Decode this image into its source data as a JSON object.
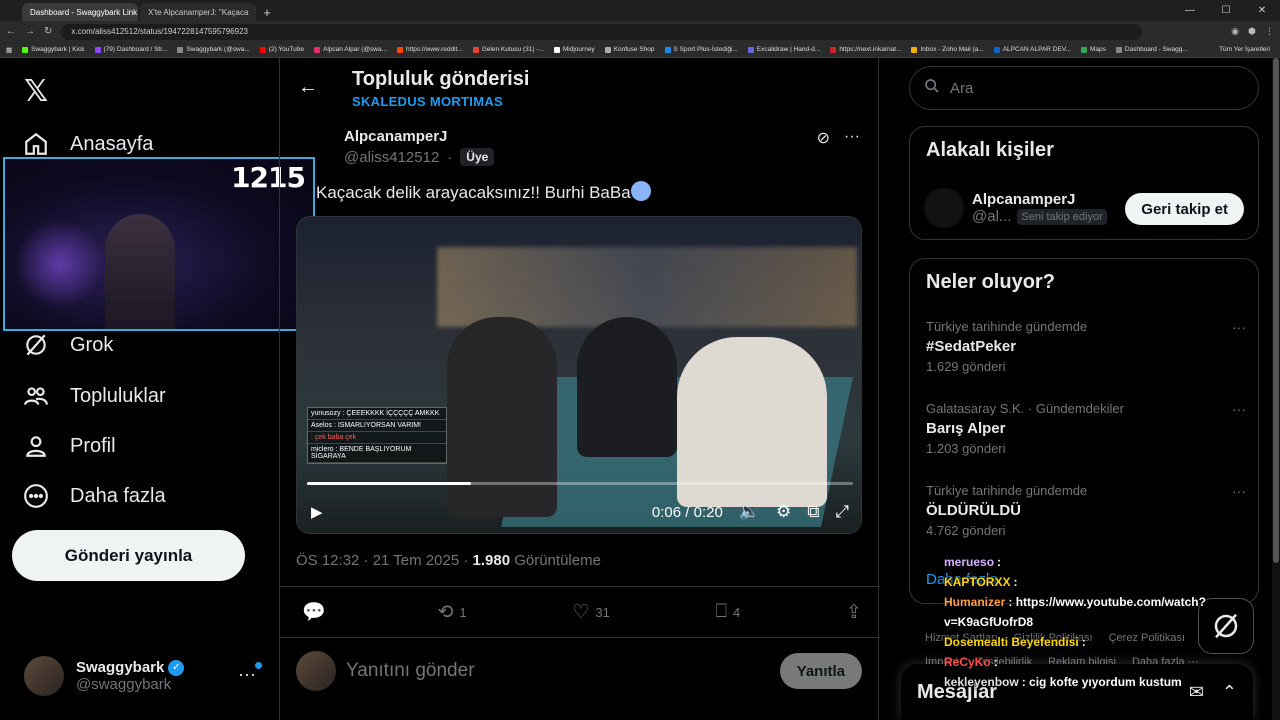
{
  "browser": {
    "tabs": [
      {
        "label": "Dashboard - Swaggybark Link"
      },
      {
        "label": "X'te AlpcanamperJ: \"Kaçaca"
      }
    ],
    "url": "x.com/aliss412512/status/1947228147595796923",
    "bookmarks": [
      {
        "label": "Swaggybark | Kick",
        "color": "#53fc18"
      },
      {
        "label": "(79) Dashboard / Str...",
        "color": "#9146ff"
      },
      {
        "label": "Swaggybark (@swa...",
        "color": "#888"
      },
      {
        "label": "(2) YouTube",
        "color": "#ff0000"
      },
      {
        "label": "Alpcan Alpar (@swa...",
        "color": "#e1306c"
      },
      {
        "label": "https://www.reddit...",
        "color": "#ff4500"
      },
      {
        "label": "Gelen Kutusu (31) -...",
        "color": "#ea4335"
      },
      {
        "label": "Midjourney",
        "color": "#fff"
      },
      {
        "label": "Konfuse Shop",
        "color": "#aaa"
      },
      {
        "label": "S Sport Plus-İstediği...",
        "color": "#1e88e5"
      },
      {
        "label": "Excalidraw | Hand-d...",
        "color": "#6965db"
      },
      {
        "label": "https://next.inkarnat...",
        "color": "#c62828"
      },
      {
        "label": "Inbox - Zoho Mail (a...",
        "color": "#f0b400"
      },
      {
        "label": "ALPCAN ALPAR DEV...",
        "color": "#1565c0"
      },
      {
        "label": "Maps",
        "color": "#34a853"
      },
      {
        "label": "Dashboard - Swagg...",
        "color": "#888"
      }
    ],
    "bookmarks_right": "Tüm Yer İşaretleri"
  },
  "sidebar": {
    "logo": "𝕏",
    "items": [
      {
        "label": "Anasayfa",
        "icon": "home-icon"
      },
      {
        "label": "Grok",
        "icon": "grok-icon"
      },
      {
        "label": "Topluluklar",
        "icon": "communities-icon"
      },
      {
        "label": "Profil",
        "icon": "profile-icon"
      },
      {
        "label": "Daha fazla",
        "icon": "more-icon"
      }
    ],
    "post_button": "Gönderi yayınla",
    "account": {
      "name": "Swaggybark",
      "handle": "@swaggybark"
    }
  },
  "webcam": {
    "counter": "1215"
  },
  "post": {
    "header_title": "Topluluk gönderisi",
    "header_sub": "SKALEDUS MORTIMAS",
    "author_name": "AlpcanamperJ",
    "author_handle": "@aliss412512",
    "badge": "Üye",
    "text": "Kaçacak delik arayacaksınız!! Burhi BaBa",
    "video": {
      "current_time": "0:06",
      "duration": "0:20",
      "progress_fraction": 0.3,
      "chat": [
        {
          "user": "yunusozy",
          "text": "ÇEEEKKKK İÇÇÇÇÇ AMKKK"
        },
        {
          "user": "Aselos",
          "text": "ISMARLIYORSAN VARIM!"
        },
        {
          "user": "",
          "text": ": çek baba çek"
        },
        {
          "user": "miclero",
          "text": "BENDE BAŞLIYORUM SİGARAYA"
        }
      ]
    },
    "meta": {
      "time": "ÖS 12:32 · 21 Tem 2025 · ",
      "views": "1.980",
      "views_label": " Görüntüleme"
    },
    "actions": {
      "replies": "",
      "reposts": "1",
      "likes": "31",
      "bookmarks": "4"
    },
    "reply_placeholder": "Yanıtını gönder",
    "reply_button": "Yanıtla"
  },
  "right": {
    "search_placeholder": "Ara",
    "related_title": "Alakalı kişiler",
    "related": {
      "name": "AlpcanamperJ",
      "handle": "@al...",
      "tag": "Seni takip ediyor",
      "button": "Geri takip et"
    },
    "trends_title": "Neler oluyor?",
    "trends": [
      {
        "context": "Türkiye tarihinde gündemde",
        "title": "#SedatPeker",
        "count": "1.629 gönderi"
      },
      {
        "context": "Galatasaray S.K. · Gündemdekiler",
        "title": "Barış Alper",
        "count": "1.203 gönderi"
      },
      {
        "context": "Türkiye tarihinde gündemde",
        "title": "ÖLDÜRÜLDÜ",
        "count": "4.762 gönderi"
      }
    ],
    "show_more": "Daha fazla",
    "footer": [
      "Hizmet Şartları",
      "Gizlilik Politikası",
      "Çerez Politikası",
      "Imprint",
      "Erişilebilirlik",
      "Reklam bilgisi",
      "Daha fazla ···"
    ],
    "messages_title": "Mesajlar"
  },
  "stream_chat": [
    {
      "user": "merueso",
      "text": ":",
      "color": "#d7b3ff"
    },
    {
      "user": "KAPTORXX",
      "text": ":",
      "color": "#ffd700"
    },
    {
      "user": "Humanizer",
      "text": ": https://www.youtube.com/watch?v=K9aGfUofrD8",
      "color": "#ff9f43"
    },
    {
      "user": "Dosemealti Beyefendisi",
      "text": ":",
      "color": "#ffd700"
    },
    {
      "user": "ReCyKo",
      "text": ":",
      "color": "#ff4d4d"
    },
    {
      "user": "kekleyenbow",
      "text": ": cig kofte yıyordum kustum",
      "color": "#e0e0e0"
    }
  ]
}
